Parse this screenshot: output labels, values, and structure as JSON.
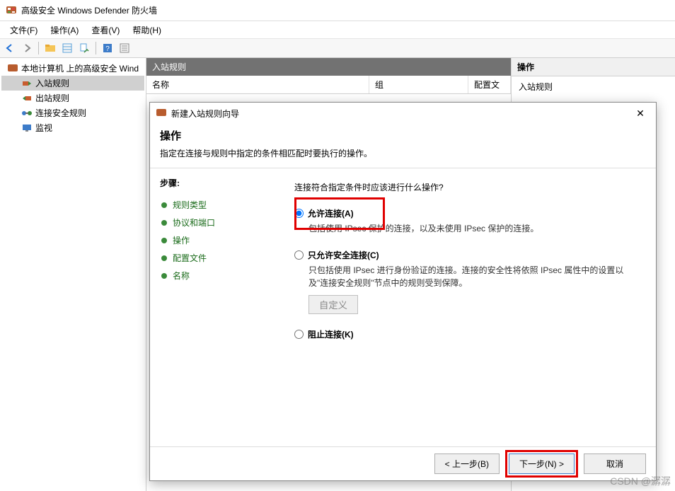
{
  "window": {
    "title": "高级安全 Windows Defender 防火墙"
  },
  "menubar": {
    "file": "文件(F)",
    "action": "操作(A)",
    "view": "查看(V)",
    "help": "帮助(H)"
  },
  "tree": {
    "root": "本地计算机 上的高级安全 Wind",
    "inbound": "入站规则",
    "outbound": "出站规则",
    "connsec": "连接安全规则",
    "monitor": "监视"
  },
  "mid": {
    "header": "入站规则",
    "col_name": "名称",
    "col_group": "组",
    "col_profile": "配置文"
  },
  "right": {
    "header": "操作",
    "sub": "入站规则"
  },
  "wizard": {
    "title": "新建入站规则向导",
    "heading": "操作",
    "sub": "指定在连接与规则中指定的条件相匹配时要执行的操作。",
    "steps_header": "步骤:",
    "steps": {
      "type": "规则类型",
      "proto": "协议和端口",
      "action": "操作",
      "profile": "配置文件",
      "name": "名称"
    },
    "question": "连接符合指定条件时应该进行什么操作?",
    "opt_allow": {
      "label": "允许连接(A)",
      "desc": "包括使用 IPsec 保护的连接，以及未使用 IPsec 保护的连接。"
    },
    "opt_secure": {
      "label": "只允许安全连接(C)",
      "desc": "只包括使用 IPsec 进行身份验证的连接。连接的安全性将依照 IPsec 属性中的设置以及\"连接安全规则\"节点中的规则受到保障。",
      "custom": "自定义"
    },
    "opt_block": {
      "label": "阻止连接(K)"
    },
    "btn_back": "< 上一步(B)",
    "btn_next": "下一步(N) >",
    "btn_cancel": "取消"
  },
  "watermark": "CSDN @潺潺"
}
